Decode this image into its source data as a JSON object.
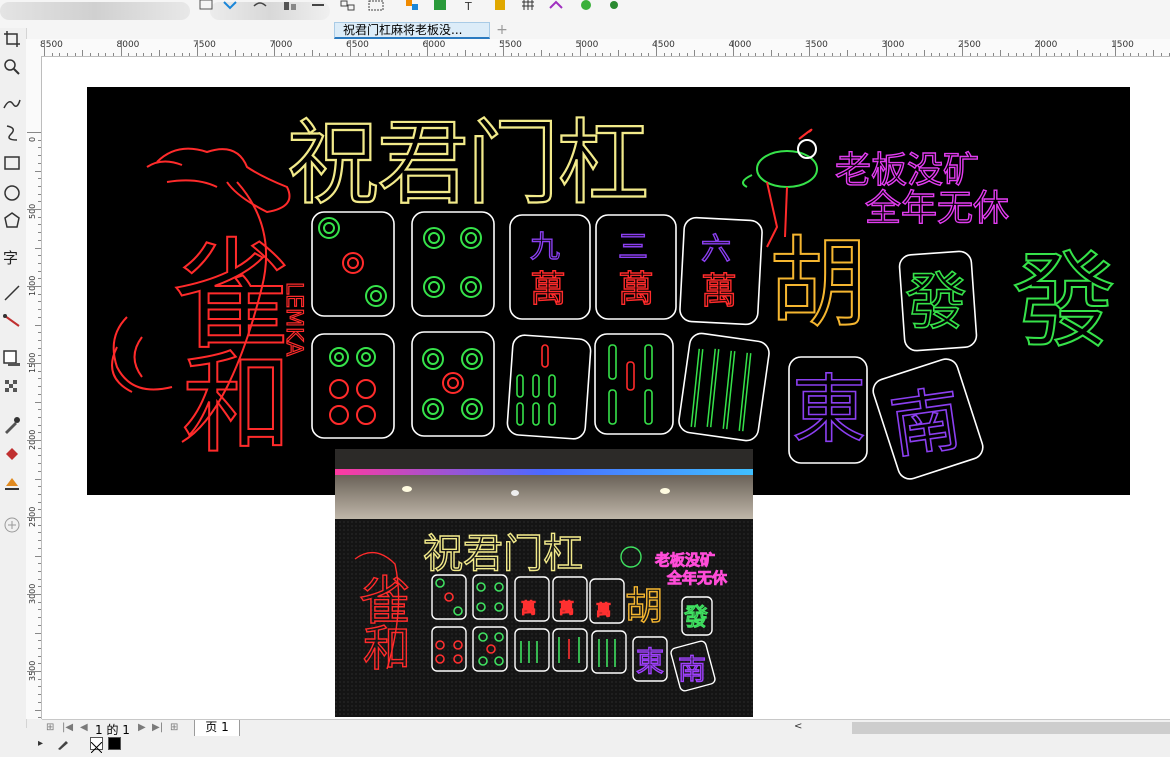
{
  "document": {
    "tab_title": "祝君门杠麻将老板没...",
    "page_label": "1 的 1",
    "page_tab": "页 1"
  },
  "ruler": {
    "h_ticks": [
      "8500",
      "8000",
      "7500",
      "7000",
      "6500",
      "6000",
      "5500",
      "5000",
      "4500",
      "4000",
      "3500",
      "3000",
      "2500",
      "2000",
      "1500"
    ],
    "v_ticks": [
      "0",
      "500",
      "1000",
      "1500",
      "2000",
      "2500",
      "3000",
      "3500"
    ]
  },
  "artwork": {
    "headline": "祝君门杠",
    "slogan_line1": "老板没矿",
    "slogan_line2": "全年无休",
    "wan_tiles": [
      {
        "top": "九",
        "bottom": "萬"
      },
      {
        "top": "三",
        "bottom": "萬"
      },
      {
        "top": "六",
        "bottom": "萬"
      }
    ],
    "hu": "胡",
    "fa": "發",
    "fa_big": "發",
    "dong": "東",
    "nan": "南",
    "que": "雀",
    "he": "和",
    "side_latin": "LEMKA",
    "colors": {
      "yellow": "#f2ea8a",
      "red": "#ff2b2b",
      "green": "#36e24a",
      "magenta": "#e23cf0",
      "purple": "#8b3ff0",
      "orange": "#f5b630",
      "white": "#ffffff"
    }
  },
  "status": {
    "fill_swatch": "#000000",
    "outline_swatch": "none"
  }
}
